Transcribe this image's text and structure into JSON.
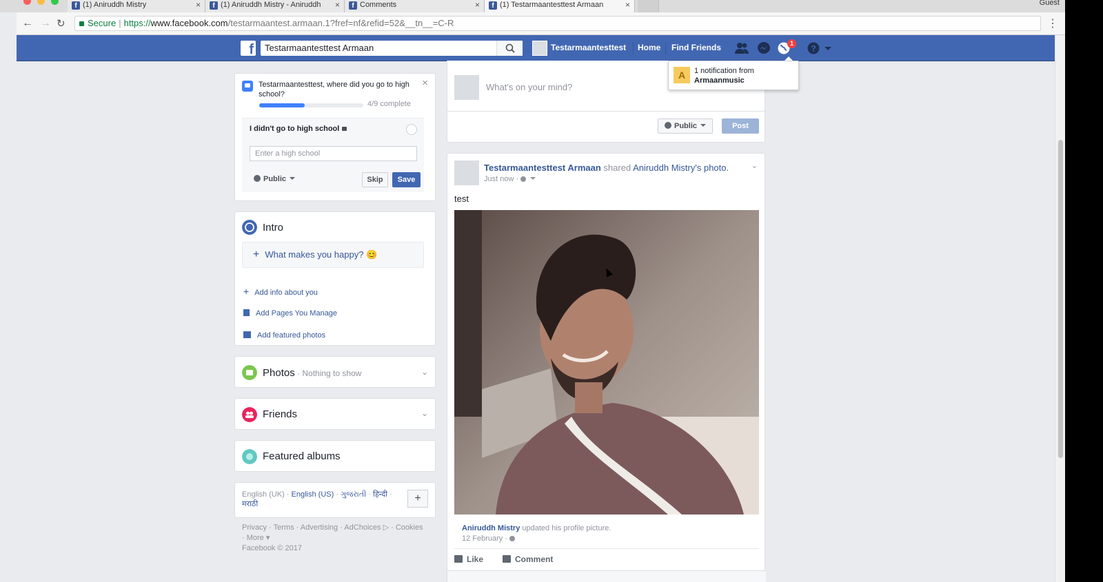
{
  "browser": {
    "tabs": [
      {
        "title": "(1) Aniruddh Mistry",
        "active": false
      },
      {
        "title": "(1) Aniruddh Mistry - Aniruddh",
        "active": false
      },
      {
        "title": "Comments",
        "active": false
      },
      {
        "title": "(1) Testarmaantesttest Armaan",
        "active": true
      }
    ],
    "profile_label": "Guest",
    "secure_label": "Secure",
    "url_scheme": "https://",
    "url_host": "www.facebook.com",
    "url_path": "/testarmaantest.armaan.1?fref=nf&refid=52&__tn__=C-R"
  },
  "fb_header": {
    "search_value": "Testarmaantesttest Armaan",
    "profile_name": "Testarmaantesttest",
    "home_label": "Home",
    "find_friends_label": "Find Friends",
    "notification_count": "1",
    "brand_color": "#4267b2"
  },
  "notification_flyout": {
    "line1": "1 notification from",
    "sender": "Armaanmusic",
    "avatar_letter": "A"
  },
  "high_school": {
    "question": "Testarmaantesttest, where did you go to high school?",
    "progress_fraction": 0.44,
    "progress_text": "4/9 complete",
    "no_hs_label": "I didn't go to high school",
    "input_placeholder": "Enter a high school",
    "privacy_label": "Public",
    "skip_label": "Skip",
    "save_label": "Save"
  },
  "intro": {
    "title": "Intro",
    "happy_prompt": "What makes you happy? 😊",
    "links": [
      "Add info about you",
      "Add Pages You Manage",
      "Add featured photos"
    ]
  },
  "photos": {
    "title": "Photos",
    "subtitle": " · Nothing to show"
  },
  "friends": {
    "title": "Friends"
  },
  "featured_albums": {
    "title": "Featured albums"
  },
  "languages": {
    "current": "English (UK) · ",
    "options": [
      "English (US)",
      " · ",
      "ગુજરાતી",
      " · ",
      "हिन्दी",
      " · ",
      "मराठी"
    ]
  },
  "footer": {
    "line1": "Privacy · Terms · Advertising · AdChoices ▷ · Cookies",
    "line2": "· More ▾",
    "copyright": "Facebook © 2017"
  },
  "composer": {
    "placeholder": "What's on your mind?",
    "privacy_label": "Public",
    "post_label": "Post"
  },
  "post": {
    "author": "Testarmaantesttest Armaan",
    "shared_word": " shared ",
    "original_author": "Aniruddh Mistry",
    "possessive_photo": "'s photo.",
    "time": "Just now · ",
    "text": "test",
    "shared_by": "Aniruddh Mistry",
    "shared_action": " updated his profile picture.",
    "shared_date": "12 February · ",
    "like_label": "Like",
    "comment_label": "Comment"
  }
}
